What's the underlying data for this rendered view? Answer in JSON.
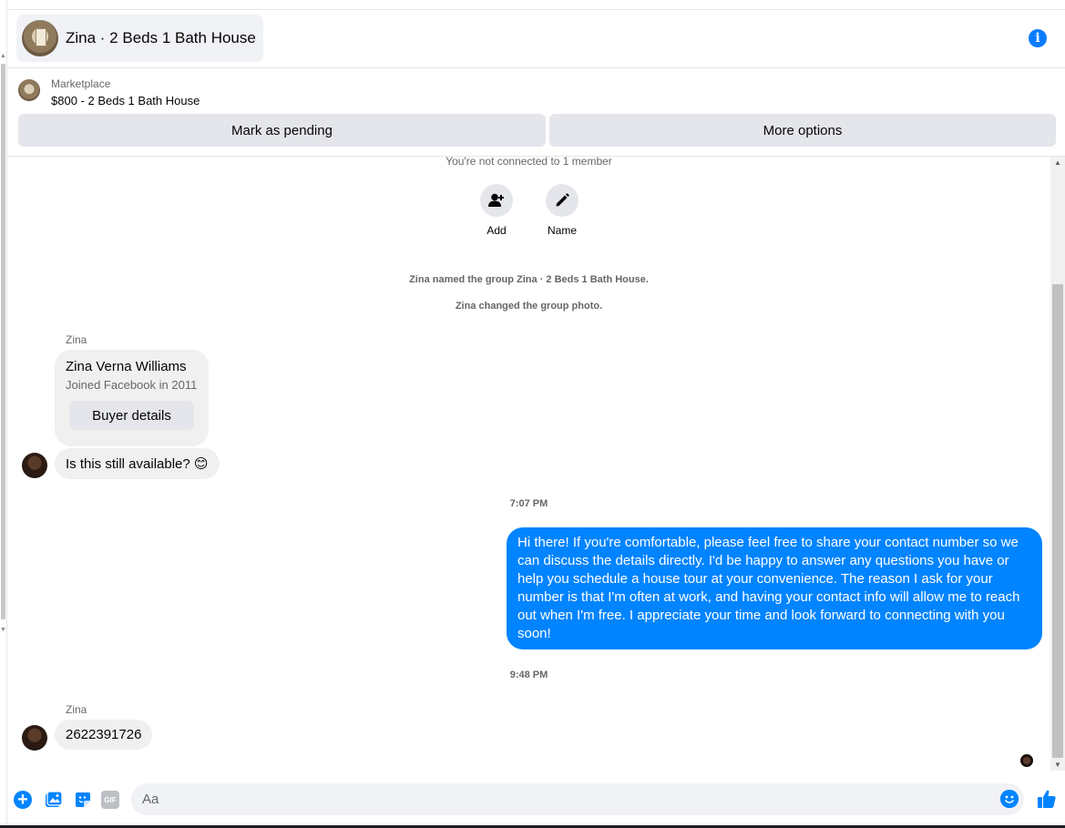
{
  "header": {
    "title": "Zina · 2 Beds 1 Bath House",
    "info_icon": "info-icon"
  },
  "listing": {
    "source": "Marketplace",
    "title": "$800 - 2 Beds 1 Bath House",
    "mark_pending_label": "Mark as pending",
    "more_options_label": "More options"
  },
  "chat": {
    "connection_note": "You're not connected to 1 member",
    "actions": [
      {
        "label": "Add",
        "icon": "add-person-icon"
      },
      {
        "label": "Name",
        "icon": "pencil-icon"
      }
    ],
    "system_notes": [
      "Zina named the group Zina · 2 Beds 1 Bath House.",
      "Zina changed the group photo."
    ],
    "sender_name_1": "Zina",
    "profile_card": {
      "name": "Zina Verna Williams",
      "joined": "Joined Facebook in 2011",
      "button_label": "Buyer details"
    },
    "message_1": "Is this still available? 😊",
    "time_1": "7:07 PM",
    "outgoing_message": "Hi there! If you're comfortable, please feel free to share your contact number so we can discuss the details directly. I'd be happy to answer any questions you have or help you schedule a house tour at your convenience. The reason I ask for your number is that I'm often at work, and having your contact info will allow me to reach out when I'm free. I appreciate your time and look forward to connecting with you soon!",
    "time_2": "9:48 PM",
    "sender_name_2": "Zina",
    "message_2": "2622391726"
  },
  "composer": {
    "placeholder": "Aa",
    "gif_label": "GIF",
    "icons": [
      "plus-icon",
      "photo-icon",
      "sticker-icon",
      "gif-icon",
      "emoji-icon",
      "like-icon"
    ]
  },
  "colors": {
    "accent": "#0084ff",
    "bubble_in": "#f0f0f0",
    "button_bg": "#e4e6eb",
    "muted_text": "#65676b"
  }
}
